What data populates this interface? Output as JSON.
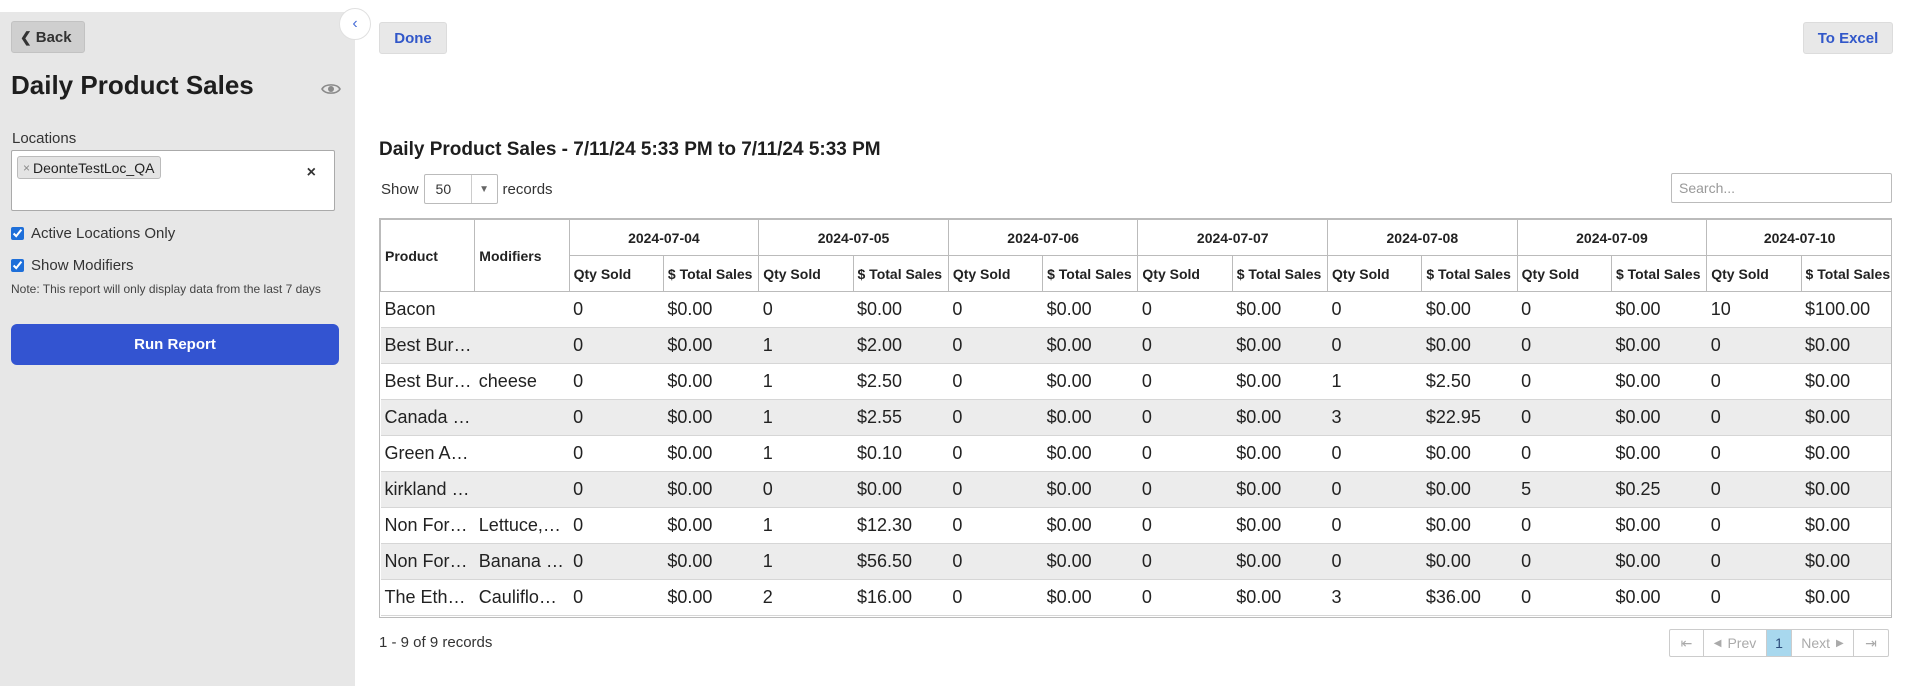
{
  "sidebar": {
    "back_label": "Back",
    "title": "Daily Product Sales",
    "locations_label": "Locations",
    "location_chip": "DeonteTestLoc_QA",
    "chip_remove": "×",
    "clear": "×",
    "active_only_label": "Active Locations Only",
    "active_only_checked": true,
    "show_modifiers_label": "Show Modifiers",
    "show_modifiers_checked": true,
    "note": "Note: This report will only display data from the last 7 days",
    "run_label": "Run Report"
  },
  "toolbar": {
    "done_label": "Done",
    "excel_label": "To Excel"
  },
  "report": {
    "title": "Daily Product Sales - 7/11/24 5:33 PM to 7/11/24 5:33 PM",
    "show_label": "Show",
    "page_size": "50",
    "records_label": "records",
    "search_placeholder": "Search..."
  },
  "table": {
    "col_product": "Product",
    "col_modifiers": "Modifiers",
    "dates": [
      "2024-07-04",
      "2024-07-05",
      "2024-07-06",
      "2024-07-07",
      "2024-07-08",
      "2024-07-09",
      "2024-07-10"
    ],
    "sub_qty": "Qty Sold",
    "sub_total": "$ Total Sales",
    "rows": [
      {
        "product": "Bacon",
        "modifiers": "",
        "cells": [
          "0",
          "$0.00",
          "0",
          "$0.00",
          "0",
          "$0.00",
          "0",
          "$0.00",
          "0",
          "$0.00",
          "0",
          "$0.00",
          "10",
          "$100.00"
        ]
      },
      {
        "product": "Best Bur…",
        "modifiers": "",
        "cells": [
          "0",
          "$0.00",
          "1",
          "$2.00",
          "0",
          "$0.00",
          "0",
          "$0.00",
          "0",
          "$0.00",
          "0",
          "$0.00",
          "0",
          "$0.00"
        ]
      },
      {
        "product": "Best Bur…",
        "modifiers": "cheese",
        "cells": [
          "0",
          "$0.00",
          "1",
          "$2.50",
          "0",
          "$0.00",
          "0",
          "$0.00",
          "1",
          "$2.50",
          "0",
          "$0.00",
          "0",
          "$0.00"
        ]
      },
      {
        "product": "Canada …",
        "modifiers": "",
        "cells": [
          "0",
          "$0.00",
          "1",
          "$2.55",
          "0",
          "$0.00",
          "0",
          "$0.00",
          "3",
          "$22.95",
          "0",
          "$0.00",
          "0",
          "$0.00"
        ]
      },
      {
        "product": "Green A…",
        "modifiers": "",
        "cells": [
          "0",
          "$0.00",
          "1",
          "$0.10",
          "0",
          "$0.00",
          "0",
          "$0.00",
          "0",
          "$0.00",
          "0",
          "$0.00",
          "0",
          "$0.00"
        ]
      },
      {
        "product": "kirkland …",
        "modifiers": "",
        "cells": [
          "0",
          "$0.00",
          "0",
          "$0.00",
          "0",
          "$0.00",
          "0",
          "$0.00",
          "0",
          "$0.00",
          "5",
          "$0.25",
          "0",
          "$0.00"
        ]
      },
      {
        "product": "Non For…",
        "modifiers": "Lettuce,…",
        "cells": [
          "0",
          "$0.00",
          "1",
          "$12.30",
          "0",
          "$0.00",
          "0",
          "$0.00",
          "0",
          "$0.00",
          "0",
          "$0.00",
          "0",
          "$0.00"
        ]
      },
      {
        "product": "Non For…",
        "modifiers": "Banana …",
        "cells": [
          "0",
          "$0.00",
          "1",
          "$56.50",
          "0",
          "$0.00",
          "0",
          "$0.00",
          "0",
          "$0.00",
          "0",
          "$0.00",
          "0",
          "$0.00"
        ]
      },
      {
        "product": "The Eth…",
        "modifiers": "Cauliflo…",
        "cells": [
          "0",
          "$0.00",
          "2",
          "$16.00",
          "0",
          "$0.00",
          "0",
          "$0.00",
          "3",
          "$36.00",
          "0",
          "$0.00",
          "0",
          "$0.00"
        ]
      }
    ]
  },
  "footer": {
    "count": "1 - 9 of 9 records",
    "prev_label": "Prev",
    "next_label": "Next",
    "current_page": "1"
  },
  "colors": {
    "primary_button": "#3354d1",
    "link_blue": "#3157c9",
    "sidebar_bg": "#e7e7e7",
    "pager_active": "#a8d8ee"
  }
}
